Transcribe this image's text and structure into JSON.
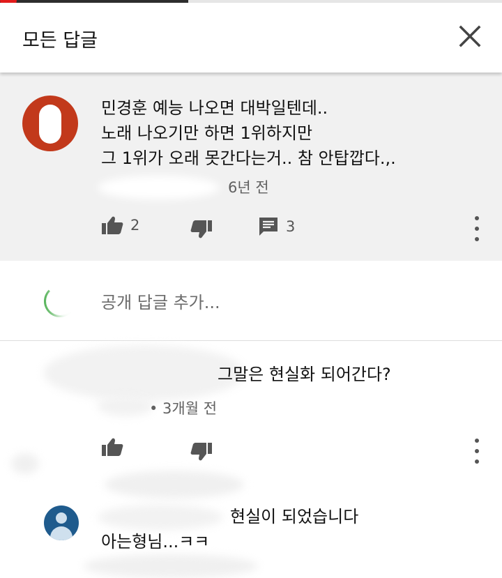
{
  "header": {
    "title": "모든 답글"
  },
  "parent_comment": {
    "text": "민경훈 예능 나오면 대박일텐데..\n노래 나오기만 하면 1위하지만\n그 1위가 오래 못간다는거.. 참 안탑깝다.,.",
    "time": "6년 전",
    "likes": "2",
    "replies": "3"
  },
  "reply_input": {
    "placeholder": "공개 답글 추가..."
  },
  "replies": [
    {
      "text": "그말은 현실화 되어간다?",
      "meta": "• 3개월 전"
    },
    {
      "text_line1": "현실이 되었습니다",
      "text_line2": "아는형님...ㅋㅋ"
    }
  ],
  "colors": {
    "accent_red": "#e21b1b",
    "parent_background": "#f1f1f1",
    "orange_avatar": "#c2391b",
    "blue_avatar": "#1f5b8d"
  }
}
